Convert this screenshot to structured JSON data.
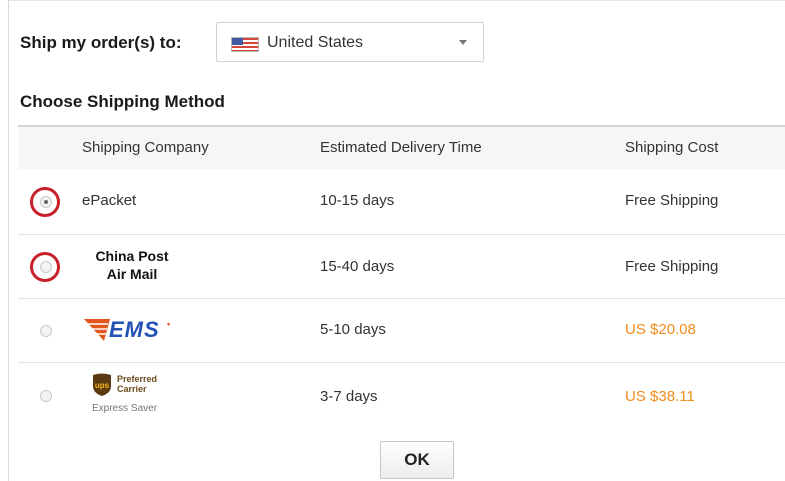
{
  "destination": {
    "label": "Ship my order(s) to:",
    "country": "United States",
    "flag_icon": "us-flag-icon"
  },
  "section_title": "Choose Shipping Method",
  "table": {
    "headers": {
      "company": "Shipping Company",
      "time": "Estimated Delivery Time",
      "cost": "Shipping Cost"
    },
    "rows": [
      {
        "company": "ePacket",
        "company_type": "text",
        "time": "10-15 days",
        "cost": "Free Shipping",
        "selected": true,
        "highlighted": true
      },
      {
        "company": "China Post Air Mail",
        "company_line1": "China Post",
        "company_line2": "Air Mail",
        "company_type": "logo-text",
        "time": "15-40 days",
        "cost": "Free Shipping",
        "selected": false,
        "highlighted": true
      },
      {
        "company": "EMS",
        "company_type": "logo",
        "logo_icon": "ems-logo",
        "time": "5-10 days",
        "cost": "US $20.08",
        "selected": false,
        "highlighted": false
      },
      {
        "company": "UPS Express Saver",
        "company_type": "logo",
        "logo_icon": "ups-logo",
        "ups_tag_line1": "Preferred",
        "ups_tag_line2": "Carrier",
        "ups_service": "Express Saver",
        "time": "3-7 days",
        "cost": "US $38.11",
        "selected": false,
        "highlighted": false
      }
    ]
  },
  "ok_label": "OK",
  "colors": {
    "paid_cost": "#f08c1c",
    "highlight_ring": "#c8202a",
    "ems_blue": "#2452b4",
    "ems_orange": "#e2561e",
    "ups_brown": "#5a3a12",
    "ups_gold": "#f4b81c"
  }
}
